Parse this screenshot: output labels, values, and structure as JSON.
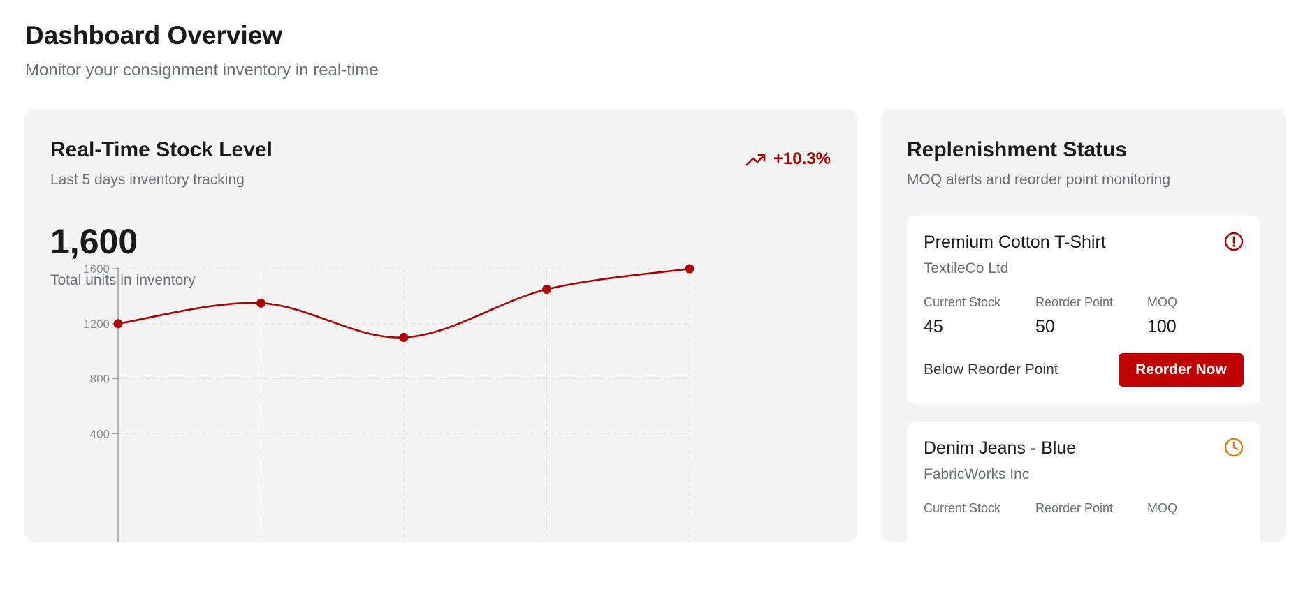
{
  "header": {
    "title": "Dashboard Overview",
    "subtitle": "Monitor your consignment inventory in real-time"
  },
  "stock": {
    "title": "Real-Time Stock Level",
    "subtitle": "Last 5 days inventory tracking",
    "trend": "+10.3%",
    "trend_icon": "trending-up-icon",
    "total": "1,600",
    "total_caption": "Total units in inventory"
  },
  "chart_data": {
    "type": "line",
    "x": [
      1,
      2,
      3,
      4,
      5
    ],
    "series": [
      {
        "values": [
          1200,
          1350,
          1100,
          1450,
          1600
        ]
      }
    ],
    "y_ticks": [
      "1600",
      "1200",
      "800",
      "400"
    ],
    "ylim": [
      0,
      1600
    ],
    "grid": true,
    "line_color": "#b30000"
  },
  "replenishment": {
    "title": "Replenishment Status",
    "subtitle": "MOQ alerts and reorder point monitoring",
    "products": [
      {
        "name": "Premium Cotton T-Shirt",
        "supplier": "TextileCo Ltd",
        "icon": "alert-circle-icon",
        "icon_color": "#b30000",
        "metric_labels": [
          "Current Stock",
          "Reorder Point",
          "MOQ"
        ],
        "metric_values": [
          "45",
          "50",
          "100"
        ],
        "status": "Below Reorder Point",
        "button": "Reorder Now"
      },
      {
        "name": "Denim Jeans - Blue",
        "supplier": "FabricWorks Inc",
        "icon": "clock-icon",
        "icon_color": "#e07a10",
        "metric_labels": [
          "Current Stock",
          "Reorder Point",
          "MOQ"
        ]
      }
    ]
  },
  "colors": {
    "accent": "#c00000",
    "muted_text": "#6b6f76",
    "card_bg": "#f4f4f4"
  }
}
